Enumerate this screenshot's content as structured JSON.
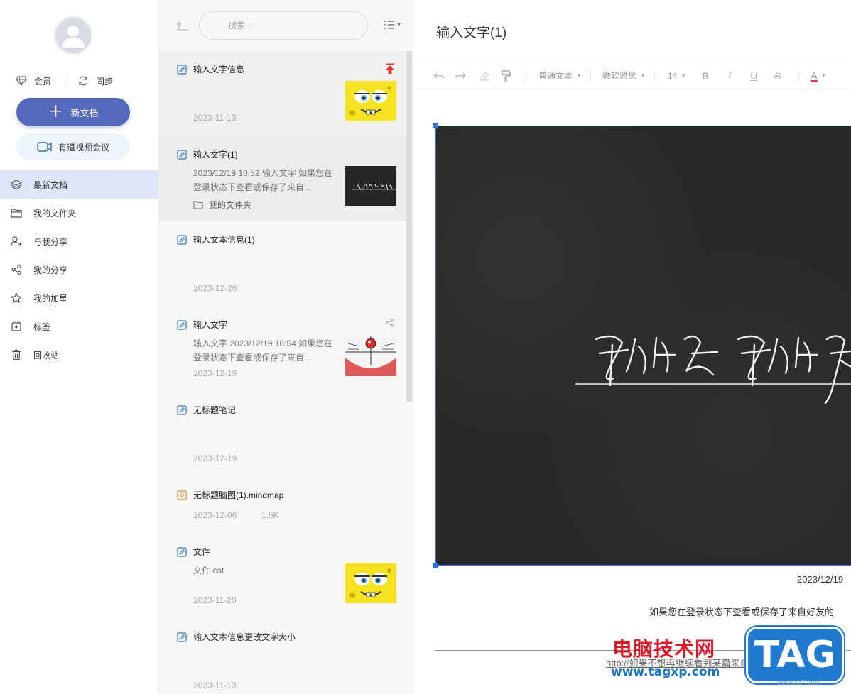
{
  "sidebar": {
    "member_label": "会员",
    "sync_label": "同步",
    "new_doc_label": "新文档",
    "meeting_label": "有道视频会议",
    "nav": [
      {
        "label": "最新文档",
        "icon": "layers-icon",
        "active": true
      },
      {
        "label": "我的文件夹",
        "icon": "folder-icon",
        "active": false
      },
      {
        "label": "与我分享",
        "icon": "shared-with-me-icon",
        "active": false
      },
      {
        "label": "我的分享",
        "icon": "share-icon",
        "active": false
      },
      {
        "label": "我的加星",
        "icon": "star-icon",
        "active": false
      },
      {
        "label": "标签",
        "icon": "tag-icon",
        "active": false
      },
      {
        "label": "回收站",
        "icon": "trash-icon",
        "active": false
      }
    ]
  },
  "list": {
    "search_placeholder": "搜索...",
    "docs": [
      {
        "title": "输入文字信息",
        "date": "2023-11-13",
        "thumb": "spongebob",
        "pinned": true
      },
      {
        "title": "输入文字(1)",
        "snippet": "2023/12/19 10:52 输入文字 如果您在登录状态下查看或保存了来自...",
        "folder": "我的文件夹",
        "thumb": "handwriting",
        "selected": true
      },
      {
        "title": "输入文本信息(1)",
        "date": "2023-12-26"
      },
      {
        "title": "输入文字",
        "snippet": "输入文字 2023/12/19 10:54 如果您在登录状态下查看或保存了来自...",
        "date": "2023-12-19",
        "thumb": "doraemon",
        "shared": true
      },
      {
        "title": "无标题笔记",
        "date": "2023-12-19"
      },
      {
        "title": "无标题脑图(1).mindmap",
        "date": "2023-12-06",
        "size": "1.5K",
        "type": "mindmap"
      },
      {
        "title": "文件",
        "snippet": "文件 cat",
        "date": "2023-11-20",
        "thumb": "spongebob"
      },
      {
        "title": "输入文本信息更改文字大小",
        "date": "2023-11-13"
      }
    ]
  },
  "editor": {
    "title": "输入文字(1)",
    "toolbar": {
      "style": "普通文本",
      "font": "微软雅黑",
      "size": "14",
      "bold": "B",
      "italic": "I",
      "underline": "U",
      "strike": "S",
      "color": "A"
    },
    "image_caption": "2023/12/19",
    "body_line": "如果您在登录状态下查看或保存了来自好友的",
    "link_line": "http://如果不想再继续看到某篇来自以下好友可"
  },
  "watermark": {
    "text": "电脑技术网",
    "url": "www.tagxp.com",
    "logo": "TAG",
    "small": "www.xz7.com"
  },
  "colors": {
    "accent": "#5469b9",
    "active_nav_bg": "#dde7f8",
    "selection_blue": "#3b6fd9",
    "pin_red": "#e53935"
  }
}
